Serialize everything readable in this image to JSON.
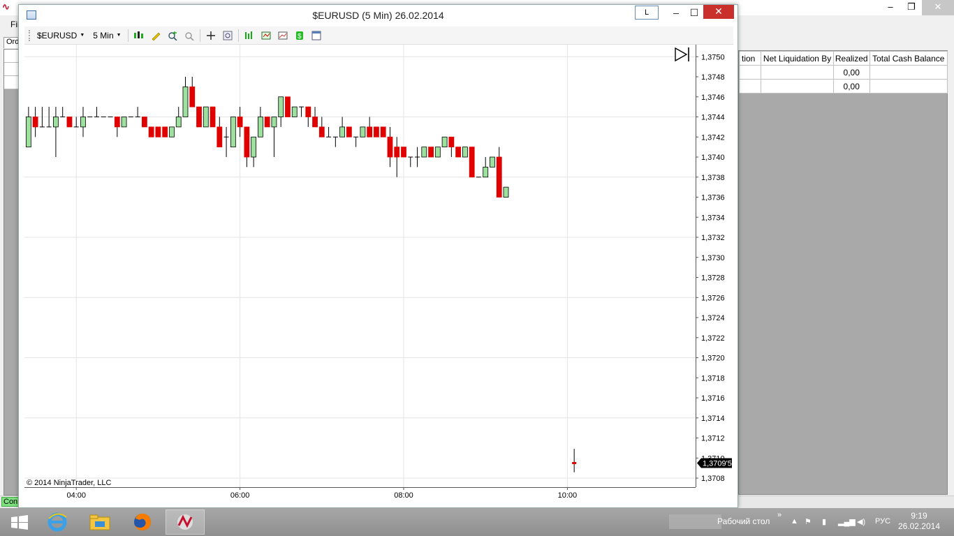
{
  "background_app": {
    "menu_first": "Fil",
    "tab_label": "Ord",
    "status_conn": "Con",
    "account_grid": {
      "columns": [
        "tion",
        "Net Liquidation By",
        "Realized",
        "Total Cash Balance"
      ],
      "rows": [
        [
          "",
          "",
          "0,00",
          ""
        ],
        [
          "",
          "",
          "0,00",
          ""
        ]
      ]
    }
  },
  "window": {
    "title": "$EURUSD (5 Min)  26.02.2014",
    "link_button": "L",
    "toolbar": {
      "instrument": "$EURUSD",
      "interval": "5 Min"
    }
  },
  "chart_data": {
    "type": "candlestick",
    "copyright": "© 2014 NinjaTrader, LLC",
    "y_ticks": [
      "1,3750",
      "1,3748",
      "1,3746",
      "1,3744",
      "1,3742",
      "1,3740",
      "1,3738",
      "1,3736",
      "1,3734",
      "1,3732",
      "1,3730",
      "1,3728",
      "1,3726",
      "1,3724",
      "1,3722",
      "1,3720",
      "1,3718",
      "1,3716",
      "1,3714",
      "1,3712",
      "1,3710",
      "1,3708"
    ],
    "ylim": [
      1.37071,
      1.37512
    ],
    "x_ticks": [
      {
        "label": "04:00",
        "minutes": 240
      },
      {
        "label": "06:00",
        "minutes": 360
      },
      {
        "label": "08:00",
        "minutes": 480
      },
      {
        "label": "10:00",
        "minutes": 600
      }
    ],
    "xlim_minutes": [
      202,
      694
    ],
    "last_price_label": "1,3709'5",
    "bull_color": "#9ee09e",
    "bear_color": "#e00000",
    "candles": [
      {
        "t": "03:10",
        "o": 1.374,
        "h": 1.3741,
        "l": 1.3739,
        "c": 1.3741
      },
      {
        "t": "03:15",
        "o": 1.374,
        "h": 1.374,
        "l": 1.3739,
        "c": 1.374
      },
      {
        "t": "03:20",
        "o": 1.374,
        "h": 1.3741,
        "l": 1.374,
        "c": 1.3741
      },
      {
        "t": "03:25",
        "o": 1.3741,
        "h": 1.3745,
        "l": 1.3741,
        "c": 1.3744
      },
      {
        "t": "03:30",
        "o": 1.3744,
        "h": 1.3745,
        "l": 1.3742,
        "c": 1.3743
      },
      {
        "t": "03:35",
        "o": 1.3743,
        "h": 1.3745,
        "l": 1.3743,
        "c": 1.3743
      },
      {
        "t": "03:40",
        "o": 1.3743,
        "h": 1.3745,
        "l": 1.3743,
        "c": 1.3743
      },
      {
        "t": "03:45",
        "o": 1.3743,
        "h": 1.3745,
        "l": 1.374,
        "c": 1.3744
      },
      {
        "t": "03:50",
        "o": 1.3744,
        "h": 1.3745,
        "l": 1.3744,
        "c": 1.3744
      },
      {
        "t": "03:55",
        "o": 1.3744,
        "h": 1.3744,
        "l": 1.3743,
        "c": 1.3743
      },
      {
        "t": "04:00",
        "o": 1.3743,
        "h": 1.3744,
        "l": 1.3743,
        "c": 1.3743
      },
      {
        "t": "04:05",
        "o": 1.3743,
        "h": 1.3745,
        "l": 1.3742,
        "c": 1.3744
      },
      {
        "t": "04:10",
        "o": 1.3744,
        "h": 1.3744,
        "l": 1.3744,
        "c": 1.3744
      },
      {
        "t": "04:15",
        "o": 1.3744,
        "h": 1.3745,
        "l": 1.3744,
        "c": 1.3744
      },
      {
        "t": "04:20",
        "o": 1.3744,
        "h": 1.3744,
        "l": 1.3744,
        "c": 1.3744
      },
      {
        "t": "04:25",
        "o": 1.3744,
        "h": 1.3744,
        "l": 1.3744,
        "c": 1.3744
      },
      {
        "t": "04:30",
        "o": 1.3744,
        "h": 1.3744,
        "l": 1.3742,
        "c": 1.3743
      },
      {
        "t": "04:35",
        "o": 1.3743,
        "h": 1.3744,
        "l": 1.3743,
        "c": 1.3744
      },
      {
        "t": "04:40",
        "o": 1.3744,
        "h": 1.3744,
        "l": 1.3744,
        "c": 1.3744
      },
      {
        "t": "04:45",
        "o": 1.3744,
        "h": 1.3745,
        "l": 1.3744,
        "c": 1.3744
      },
      {
        "t": "04:50",
        "o": 1.3744,
        "h": 1.3744,
        "l": 1.3743,
        "c": 1.3743
      },
      {
        "t": "04:55",
        "o": 1.3743,
        "h": 1.3743,
        "l": 1.3742,
        "c": 1.3742
      },
      {
        "t": "05:00",
        "o": 1.3743,
        "h": 1.3743,
        "l": 1.3742,
        "c": 1.3742
      },
      {
        "t": "05:05",
        "o": 1.3743,
        "h": 1.3743,
        "l": 1.3742,
        "c": 1.3742
      },
      {
        "t": "05:10",
        "o": 1.3742,
        "h": 1.3743,
        "l": 1.3742,
        "c": 1.3743
      },
      {
        "t": "05:15",
        "o": 1.3743,
        "h": 1.3745,
        "l": 1.3743,
        "c": 1.3744
      },
      {
        "t": "05:20",
        "o": 1.3744,
        "h": 1.3748,
        "l": 1.3744,
        "c": 1.3747
      },
      {
        "t": "05:25",
        "o": 1.3747,
        "h": 1.3748,
        "l": 1.3745,
        "c": 1.3745
      },
      {
        "t": "05:30",
        "o": 1.3745,
        "h": 1.3745,
        "l": 1.3743,
        "c": 1.3743
      },
      {
        "t": "05:35",
        "o": 1.3743,
        "h": 1.3745,
        "l": 1.3743,
        "c": 1.3745
      },
      {
        "t": "05:40",
        "o": 1.3745,
        "h": 1.3745,
        "l": 1.3743,
        "c": 1.3743
      },
      {
        "t": "05:45",
        "o": 1.3743,
        "h": 1.3744,
        "l": 1.3741,
        "c": 1.3741
      },
      {
        "t": "05:50",
        "o": 1.3742,
        "h": 1.3743,
        "l": 1.374,
        "c": 1.3742
      },
      {
        "t": "05:55",
        "o": 1.3741,
        "h": 1.3744,
        "l": 1.3741,
        "c": 1.3744
      },
      {
        "t": "06:00",
        "o": 1.3744,
        "h": 1.3745,
        "l": 1.3742,
        "c": 1.3743
      },
      {
        "t": "06:05",
        "o": 1.3743,
        "h": 1.3743,
        "l": 1.3739,
        "c": 1.374
      },
      {
        "t": "06:10",
        "o": 1.374,
        "h": 1.3742,
        "l": 1.3739,
        "c": 1.3742
      },
      {
        "t": "06:15",
        "o": 1.3742,
        "h": 1.3745,
        "l": 1.3742,
        "c": 1.3744
      },
      {
        "t": "06:20",
        "o": 1.3744,
        "h": 1.3744,
        "l": 1.3743,
        "c": 1.3743
      },
      {
        "t": "06:25",
        "o": 1.3743,
        "h": 1.3744,
        "l": 1.374,
        "c": 1.3744
      },
      {
        "t": "06:30",
        "o": 1.3744,
        "h": 1.3746,
        "l": 1.3743,
        "c": 1.3746
      },
      {
        "t": "06:35",
        "o": 1.3746,
        "h": 1.3746,
        "l": 1.3744,
        "c": 1.3744
      },
      {
        "t": "06:40",
        "o": 1.3744,
        "h": 1.3745,
        "l": 1.3744,
        "c": 1.3745
      },
      {
        "t": "06:45",
        "o": 1.3745,
        "h": 1.3745,
        "l": 1.3744,
        "c": 1.3745
      },
      {
        "t": "06:50",
        "o": 1.3745,
        "h": 1.3745,
        "l": 1.3743,
        "c": 1.3744
      },
      {
        "t": "06:55",
        "o": 1.3744,
        "h": 1.3745,
        "l": 1.3743,
        "c": 1.3743
      },
      {
        "t": "07:00",
        "o": 1.3743,
        "h": 1.3744,
        "l": 1.3742,
        "c": 1.3742
      },
      {
        "t": "07:05",
        "o": 1.3742,
        "h": 1.3743,
        "l": 1.3742,
        "c": 1.3742
      },
      {
        "t": "07:10",
        "o": 1.3742,
        "h": 1.3742,
        "l": 1.3741,
        "c": 1.3742
      },
      {
        "t": "07:15",
        "o": 1.3742,
        "h": 1.3744,
        "l": 1.3742,
        "c": 1.3743
      },
      {
        "t": "07:20",
        "o": 1.3743,
        "h": 1.3743,
        "l": 1.3742,
        "c": 1.3742
      },
      {
        "t": "07:25",
        "o": 1.3742,
        "h": 1.3742,
        "l": 1.3741,
        "c": 1.3742
      },
      {
        "t": "07:30",
        "o": 1.3742,
        "h": 1.3743,
        "l": 1.3742,
        "c": 1.3743
      },
      {
        "t": "07:35",
        "o": 1.3743,
        "h": 1.3744,
        "l": 1.3742,
        "c": 1.3742
      },
      {
        "t": "07:40",
        "o": 1.3743,
        "h": 1.3743,
        "l": 1.3742,
        "c": 1.3742
      },
      {
        "t": "07:45",
        "o": 1.3743,
        "h": 1.3743,
        "l": 1.3742,
        "c": 1.3742
      },
      {
        "t": "07:50",
        "o": 1.3742,
        "h": 1.3743,
        "l": 1.3739,
        "c": 1.374
      },
      {
        "t": "07:55",
        "o": 1.3741,
        "h": 1.3742,
        "l": 1.3738,
        "c": 1.374
      },
      {
        "t": "08:00",
        "o": 1.3741,
        "h": 1.3741,
        "l": 1.374,
        "c": 1.374
      },
      {
        "t": "08:05",
        "o": 1.374,
        "h": 1.374,
        "l": 1.3739,
        "c": 1.374
      },
      {
        "t": "08:10",
        "o": 1.374,
        "h": 1.3741,
        "l": 1.3739,
        "c": 1.374
      },
      {
        "t": "08:15",
        "o": 1.374,
        "h": 1.3741,
        "l": 1.374,
        "c": 1.3741
      },
      {
        "t": "08:20",
        "o": 1.3741,
        "h": 1.3741,
        "l": 1.374,
        "c": 1.374
      },
      {
        "t": "08:25",
        "o": 1.374,
        "h": 1.3741,
        "l": 1.374,
        "c": 1.3741
      },
      {
        "t": "08:30",
        "o": 1.3741,
        "h": 1.3742,
        "l": 1.3741,
        "c": 1.3742
      },
      {
        "t": "08:35",
        "o": 1.3742,
        "h": 1.3742,
        "l": 1.374,
        "c": 1.3741
      },
      {
        "t": "08:40",
        "o": 1.3741,
        "h": 1.3741,
        "l": 1.374,
        "c": 1.374
      },
      {
        "t": "08:45",
        "o": 1.374,
        "h": 1.3741,
        "l": 1.374,
        "c": 1.3741
      },
      {
        "t": "08:50",
        "o": 1.3741,
        "h": 1.3741,
        "l": 1.3738,
        "c": 1.3738
      },
      {
        "t": "08:55",
        "o": 1.3738,
        "h": 1.3738,
        "l": 1.3738,
        "c": 1.3738
      },
      {
        "t": "09:00",
        "o": 1.3738,
        "h": 1.374,
        "l": 1.3738,
        "c": 1.3739
      },
      {
        "t": "09:05",
        "o": 1.3739,
        "h": 1.374,
        "l": 1.3739,
        "c": 1.374
      },
      {
        "t": "09:10",
        "o": 1.374,
        "h": 1.3741,
        "l": 1.3736,
        "c": 1.3736
      },
      {
        "t": "09:15",
        "o": 1.3736,
        "h": 1.3737,
        "l": 1.3736,
        "c": 1.3737
      }
    ],
    "last_tick": {
      "t": "10:05",
      "o": 1.37095,
      "h": 1.37105,
      "l": 1.3709,
      "c": 1.37095
    }
  },
  "taskbar": {
    "desktop_label": "Рабочий стол",
    "lang": "РУС",
    "time": "9:19",
    "date": "26.02.2014"
  }
}
